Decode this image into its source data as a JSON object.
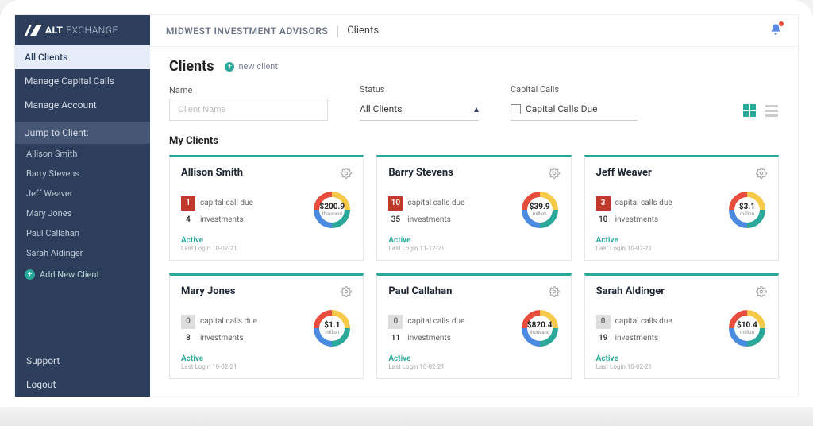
{
  "brand": {
    "bold": "ALT",
    "light": "EXCHANGE"
  },
  "sidebar": {
    "nav": [
      {
        "label": "All Clients",
        "active": true
      },
      {
        "label": "Manage Capital Calls",
        "active": false
      },
      {
        "label": "Manage Account",
        "active": false
      }
    ],
    "jump_label": "Jump to Client:",
    "clients": [
      "Allison Smith",
      "Barry Stevens",
      "Jeff Weaver",
      "Mary Jones",
      "Paul Callahan",
      "Sarah Aldinger"
    ],
    "add_label": "Add New Client",
    "support": "Support",
    "logout": "Logout"
  },
  "header": {
    "firm": "MIDWEST INVESTMENT ADVISORS",
    "crumb": "Clients"
  },
  "page": {
    "title": "Clients",
    "new_client": "new client",
    "section": "My Clients"
  },
  "filters": {
    "name_label": "Name",
    "name_placeholder": "Client Name",
    "status_label": "Status",
    "status_value": "All Clients",
    "capital_label": "Capital Calls",
    "capital_checkbox": "Capital Calls Due"
  },
  "labels": {
    "cc_due_singular": "capital call due",
    "cc_due_plural": "capital calls due",
    "investments": "investments",
    "status_active": "Active",
    "last_login_prefix": "Last Login"
  },
  "clients": [
    {
      "name": "Allison Smith",
      "calls_due": 1,
      "calls_red": true,
      "investments": 4,
      "value": "$200.9",
      "unit": "thousand",
      "last_login": "10-02-21"
    },
    {
      "name": "Barry Stevens",
      "calls_due": 10,
      "calls_red": true,
      "investments": 35,
      "value": "$39.9",
      "unit": "million",
      "last_login": "11-12-21"
    },
    {
      "name": "Jeff Weaver",
      "calls_due": 3,
      "calls_red": true,
      "investments": 10,
      "value": "$3.1",
      "unit": "million",
      "last_login": "10-02-21"
    },
    {
      "name": "Mary Jones",
      "calls_due": 0,
      "calls_red": false,
      "investments": 8,
      "value": "$1.1",
      "unit": "million",
      "last_login": "10-02-21"
    },
    {
      "name": "Paul Callahan",
      "calls_due": 0,
      "calls_red": false,
      "investments": 11,
      "value": "$820.4",
      "unit": "thousand",
      "last_login": "10-02-21"
    },
    {
      "name": "Sarah Aldinger",
      "calls_due": 0,
      "calls_red": false,
      "investments": 19,
      "value": "$10.4",
      "unit": "million",
      "last_login": "10-02-21"
    }
  ]
}
